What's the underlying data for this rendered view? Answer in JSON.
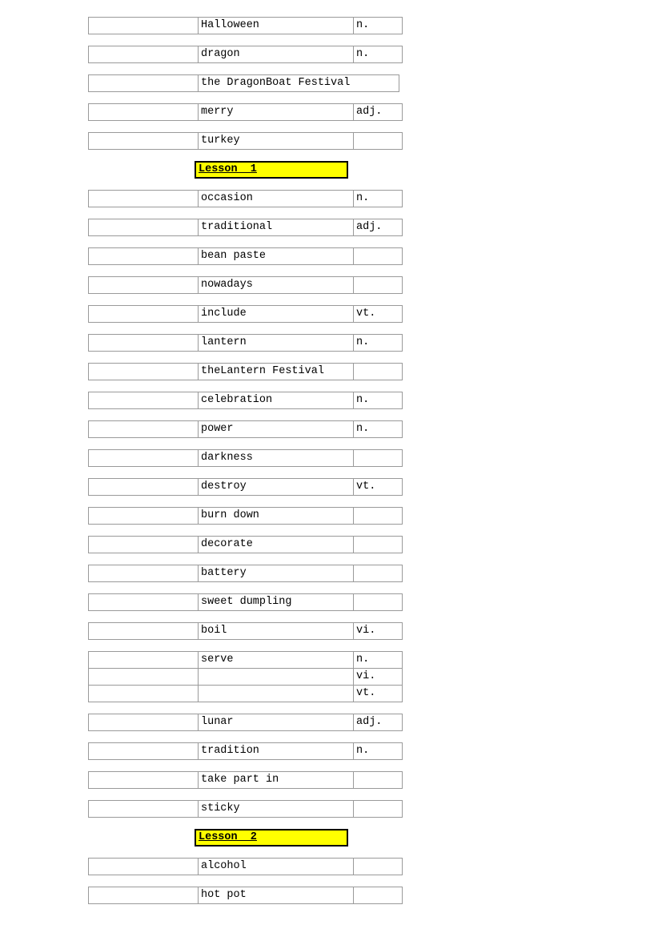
{
  "document": {
    "type": "vocabulary-word-list",
    "columns": [
      "",
      "word",
      "part_of_speech"
    ],
    "highlight_color": "#ffff00",
    "border_color": "#9a9a9a",
    "lesson_box_border_color": "#000000",
    "blocks": [
      {
        "kind": "word",
        "id": "halloween",
        "blank": "",
        "word": "Halloween",
        "pos": "n."
      },
      {
        "kind": "word",
        "id": "dragon",
        "blank": "",
        "word": "dragon",
        "pos": "n."
      },
      {
        "kind": "word",
        "id": "dragonboat",
        "blank": "",
        "word": "the DragonBoat Festival",
        "pos": "",
        "merged": true
      },
      {
        "kind": "word",
        "id": "merry",
        "blank": "",
        "word": "merry",
        "pos": "adj."
      },
      {
        "kind": "word",
        "id": "turkey",
        "blank": "",
        "word": "turkey",
        "pos": ""
      },
      {
        "kind": "lesson",
        "id": "lesson-1",
        "label": "Lesson  1"
      },
      {
        "kind": "word",
        "id": "occasion",
        "blank": "",
        "word": "occasion",
        "pos": "n."
      },
      {
        "kind": "word",
        "id": "traditional",
        "blank": "",
        "word": "traditional",
        "pos": "adj."
      },
      {
        "kind": "word",
        "id": "bean-paste",
        "blank": "",
        "word": "bean paste",
        "pos": ""
      },
      {
        "kind": "word",
        "id": "nowadays",
        "blank": "",
        "word": "nowadays",
        "pos": ""
      },
      {
        "kind": "word",
        "id": "include",
        "blank": "",
        "word": "include",
        "pos": "vt."
      },
      {
        "kind": "word",
        "id": "lantern",
        "blank": "",
        "word": "lantern",
        "pos": "n."
      },
      {
        "kind": "word",
        "id": "lantern-fest",
        "blank": "",
        "word": "theLantern Festival",
        "pos": ""
      },
      {
        "kind": "word",
        "id": "celebration",
        "blank": "",
        "word": "celebration",
        "pos": "n."
      },
      {
        "kind": "word",
        "id": "power",
        "blank": "",
        "word": "power",
        "pos": "n."
      },
      {
        "kind": "word",
        "id": "darkness",
        "blank": "",
        "word": "darkness",
        "pos": ""
      },
      {
        "kind": "word",
        "id": "destroy",
        "blank": "",
        "word": "destroy",
        "pos": "vt."
      },
      {
        "kind": "word",
        "id": "burn-down",
        "blank": "",
        "word": "burn down",
        "pos": ""
      },
      {
        "kind": "word",
        "id": "decorate",
        "blank": "",
        "word": "decorate",
        "pos": ""
      },
      {
        "kind": "word",
        "id": "battery",
        "blank": "",
        "word": "battery",
        "pos": ""
      },
      {
        "kind": "word",
        "id": "sweet-dumpling",
        "blank": "",
        "word": "sweet dumpling",
        "pos": ""
      },
      {
        "kind": "word",
        "id": "boil",
        "blank": "",
        "word": "boil",
        "pos": "vi."
      },
      {
        "kind": "stack",
        "id": "serve",
        "rows": [
          {
            "blank": "",
            "word": "serve",
            "pos": "n."
          },
          {
            "blank": "",
            "word": "",
            "pos": "vi."
          },
          {
            "blank": "",
            "word": "",
            "pos": "vt."
          }
        ]
      },
      {
        "kind": "word",
        "id": "lunar",
        "blank": "",
        "word": "lunar",
        "pos": "adj."
      },
      {
        "kind": "word",
        "id": "tradition",
        "blank": "",
        "word": "tradition",
        "pos": "n."
      },
      {
        "kind": "word",
        "id": "take-part-in",
        "blank": "",
        "word": "take part in",
        "pos": ""
      },
      {
        "kind": "word",
        "id": "sticky",
        "blank": "",
        "word": "sticky",
        "pos": ""
      },
      {
        "kind": "lesson",
        "id": "lesson-2",
        "label": "Lesson  2"
      },
      {
        "kind": "word",
        "id": "alcohol",
        "blank": "",
        "word": "alcohol",
        "pos": ""
      },
      {
        "kind": "word",
        "id": "hot-pot",
        "blank": "",
        "word": "hot pot",
        "pos": ""
      }
    ]
  }
}
